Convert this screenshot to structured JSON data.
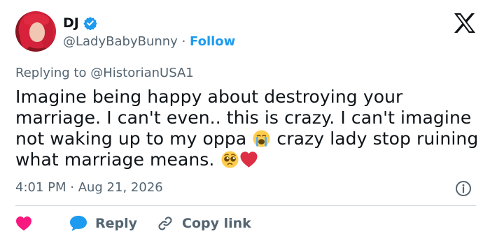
{
  "author": {
    "display_name": "DJ",
    "handle": "@LadyBabyBunny",
    "separator": "·",
    "follow_label": "Follow",
    "verified_color": "#1d9bf0"
  },
  "reply": {
    "prefix": "Replying to",
    "to_handle": "@HistorianUSA1"
  },
  "tweet": {
    "text_part1": "Imagine being happy about destroying your marriage. I can't even.. this is crazy. I can't imagine not waking up to my oppa",
    "emoji1": "loudly-crying-face",
    "text_part2": " crazy lady stop ruining what marriage means.",
    "emoji2": "pleading-face",
    "emoji3": "red-heart"
  },
  "meta": {
    "timestamp": "4:01 PM · Aug 21, 2026"
  },
  "actions": {
    "reply_label": "Reply",
    "copy_link_label": "Copy link"
  },
  "colors": {
    "accent": "#1d9bf0",
    "like": "#f91880",
    "muted": "#536471",
    "text": "#0f1419"
  }
}
